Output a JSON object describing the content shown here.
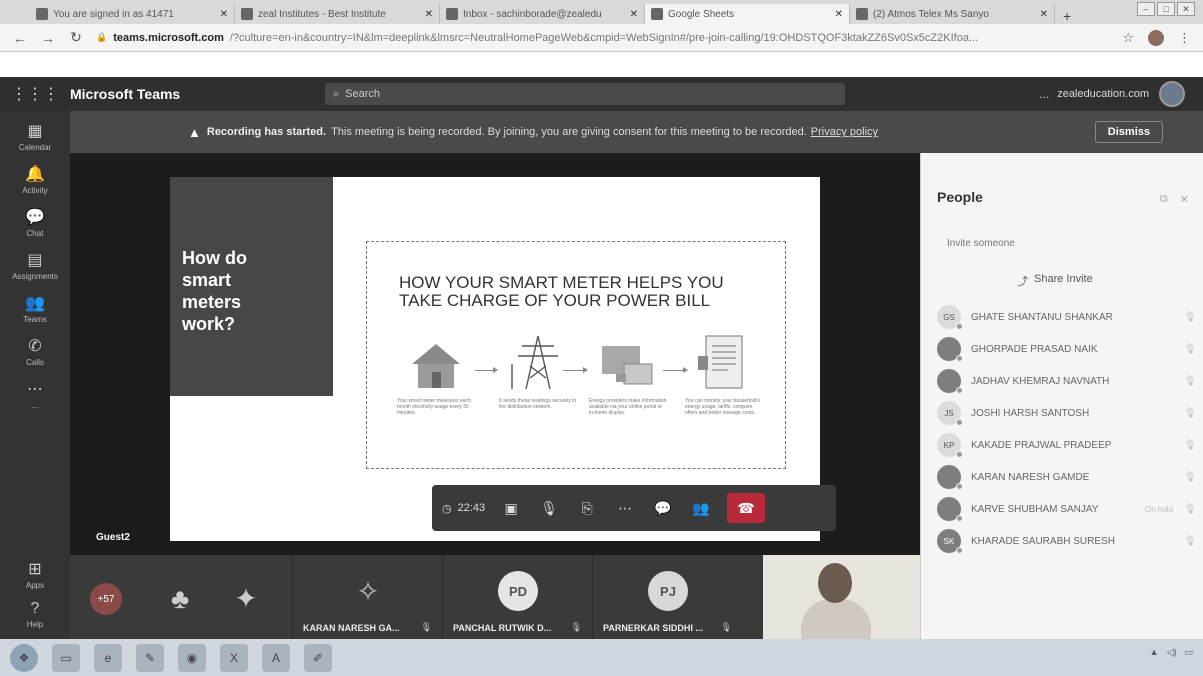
{
  "browser": {
    "tabs": [
      {
        "title": "You are signed in as 41471",
        "favicon": "teams-favicon"
      },
      {
        "title": "zeal Institutes - Best Institute",
        "favicon": "zeal-favicon"
      },
      {
        "title": "Inbox - sachinborade@zealedu",
        "favicon": "gmail-favicon"
      },
      {
        "title": "Google Sheets",
        "favicon": "sheets-favicon",
        "active": true
      },
      {
        "title": "(2) Atmos Telex Ms Sanyo",
        "favicon": "audio-favicon"
      }
    ],
    "new_tab": "+",
    "url_host": "teams.microsoft.com",
    "url_path": "/?culture=en-in&country=IN&lm=deeplink&lmsrc=NeutralHomePageWeb&cmpid=WebSignIn#/pre-join-calling/19:OHDSTQOF3ktakZZ6Sv0Sx5cZ2KIfoa..."
  },
  "teams": {
    "brand": "Microsoft Teams",
    "search_placeholder": "Search",
    "more": "...",
    "org": "zealeducation.com"
  },
  "rail": [
    {
      "label": "Calendar",
      "icon": "calendar-icon",
      "glyph": "▦"
    },
    {
      "label": "Activity",
      "icon": "bell-icon",
      "glyph": "🔔"
    },
    {
      "label": "Chat",
      "icon": "chat-icon",
      "glyph": "💬"
    },
    {
      "label": "Assignments",
      "icon": "assignments-icon",
      "glyph": "▤"
    },
    {
      "label": "Teams",
      "icon": "teams-icon",
      "glyph": "👥"
    },
    {
      "label": "Calls",
      "icon": "phone-icon",
      "glyph": "✆"
    },
    {
      "label": "...",
      "icon": "more-icon",
      "glyph": "⋯"
    }
  ],
  "rail_bottom": [
    {
      "label": "Apps",
      "icon": "apps-icon",
      "glyph": "⊞"
    },
    {
      "label": "Help",
      "icon": "help-icon",
      "glyph": "?"
    }
  ],
  "banner": {
    "bold": "Recording has started.",
    "message": "This meeting is being recorded. By joining, you are giving consent for this meeting to be recorded.",
    "link": "Privacy policy",
    "dismiss": "Dismiss"
  },
  "slide": {
    "question": "How do\nsmart\nmeters\nwork?",
    "title": "HOW YOUR SMART METER HELPS YOU\nTAKE CHARGE OF YOUR POWER BILL",
    "steps": [
      "Your smart meter measures each month electricity usage every 30 minutes.",
      "It sends these readings securely to the distribution network.",
      "Energy providers make information available via your online portal or in-home display.",
      "You can monitor your household's energy usage, tariffs, compare offers and better manage costs."
    ],
    "presenter": "Guest2"
  },
  "callbar": {
    "timer": "22:43"
  },
  "people": {
    "heading": "People",
    "invite_placeholder": "Invite someone",
    "share_invite": "Share Invite",
    "participants": [
      {
        "name": "GHATE SHANTANU SHANKAR",
        "initials": "GS",
        "type": "initials"
      },
      {
        "name": "GHORPADE PRASAD NAIK",
        "initials": "",
        "type": "photo"
      },
      {
        "name": "JADHAV KHEMRAJ NAVNATH",
        "initials": "",
        "type": "photo"
      },
      {
        "name": "JOSHI HARSH SANTOSH",
        "initials": "JS",
        "type": "initials"
      },
      {
        "name": "KAKADE PRAJWAL PRADEEP",
        "initials": "KP",
        "type": "initials"
      },
      {
        "name": "KARAN NARESH GAMDE",
        "initials": "",
        "type": "photo"
      },
      {
        "name": "KARVE SHUBHAM SANJAY",
        "initials": "",
        "type": "photo",
        "role": "On hold"
      },
      {
        "name": "KHARADE SAURABH SURESH",
        "initials": "SK",
        "type": "photo"
      }
    ]
  },
  "strip": {
    "more_count": "+57",
    "tiles": [
      {
        "label": "KARAN NARESH GA...",
        "initials": "",
        "color": "#3a3a3a"
      },
      {
        "label": "PANCHAL RUTWIK D...",
        "initials": "PD",
        "color": "#e5e5e5"
      },
      {
        "label": "PARNERKAR SIDDHI ...",
        "initials": "PJ",
        "color": "#d8d8d8"
      }
    ]
  },
  "taskbar": {
    "items": [
      {
        "name": "start-button",
        "glyph": "❖"
      },
      {
        "name": "file-explorer-icon",
        "glyph": "▭"
      },
      {
        "name": "ie-icon",
        "glyph": "e"
      },
      {
        "name": "paint-icon",
        "glyph": "✎"
      },
      {
        "name": "chrome-icon",
        "glyph": "◉"
      },
      {
        "name": "excel-icon",
        "glyph": "X"
      },
      {
        "name": "pdf-icon",
        "glyph": "A"
      },
      {
        "name": "notepad-icon",
        "glyph": "✐"
      }
    ]
  }
}
